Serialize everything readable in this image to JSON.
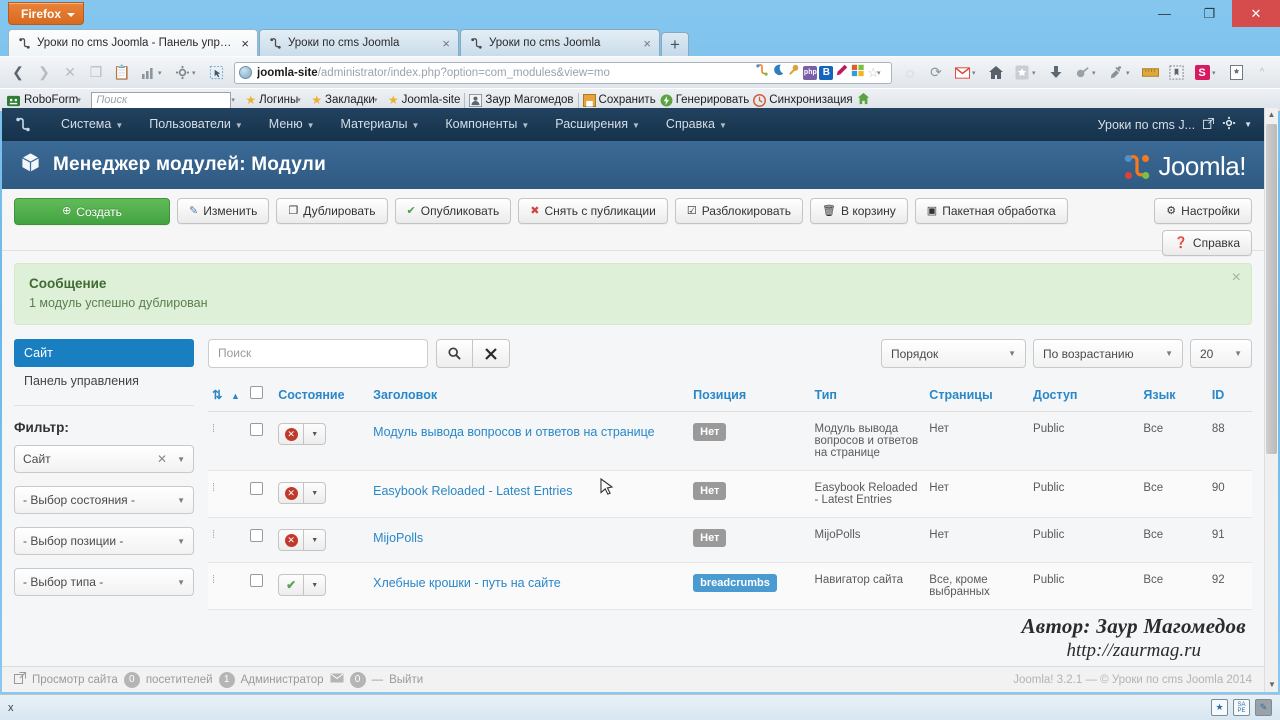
{
  "browser": {
    "app_button": "Firefox",
    "tabs": [
      {
        "title": "Уроки по cms Joomla - Панель упра...",
        "active": true,
        "close": "×"
      },
      {
        "title": "Уроки по cms Joomla",
        "active": false,
        "close": "×"
      },
      {
        "title": "Уроки по cms Joomla",
        "active": false,
        "close": "×"
      }
    ],
    "new_tab": "+",
    "window_controls": {
      "minimize": "—",
      "maximize": "❐",
      "close": "✕"
    },
    "url": {
      "host": "joomla-site",
      "path": "/administrator/index.php?option=com_modules&view=mo"
    },
    "bookmarks": {
      "roboform": "RoboForm",
      "search_placeholder": "Поиск",
      "items": [
        "Логины",
        "Закладки",
        "Joomla-site",
        "Заур Магомедов",
        "Сохранить",
        "Генерировать",
        "Синхронизация"
      ]
    }
  },
  "admin": {
    "topnav": [
      "Система",
      "Пользователи",
      "Меню",
      "Материалы",
      "Компоненты",
      "Расширения",
      "Справка"
    ],
    "site_name": "Уроки по cms J...",
    "brand": "Joomla!",
    "page_title": "Менеджер модулей: Модули"
  },
  "toolbar": {
    "new": "Создать",
    "edit": "Изменить",
    "duplicate": "Дублировать",
    "publish": "Опубликовать",
    "unpublish": "Снять с публикации",
    "checkin": "Разблокировать",
    "trash": "В корзину",
    "batch": "Пакетная обработка",
    "options": "Настройки",
    "help": "Справка"
  },
  "alert": {
    "heading": "Сообщение",
    "text": "1 модуль успешно дублирован",
    "close": "×"
  },
  "sidebar": {
    "nav": [
      {
        "label": "Сайт",
        "active": true
      },
      {
        "label": "Панель управления",
        "active": false
      }
    ],
    "filter_heading": "Фильтр:",
    "filters": [
      {
        "value": "Сайт",
        "clearable": true
      },
      {
        "value": "- Выбор состояния -",
        "clearable": false
      },
      {
        "value": "- Выбор позиции -",
        "clearable": false
      },
      {
        "value": "- Выбор типа -",
        "clearable": false
      }
    ]
  },
  "search": {
    "placeholder": "Поиск",
    "value": "",
    "search_icon": "search-icon",
    "clear_icon": "clear-icon"
  },
  "ordering": {
    "sort": "Порядок",
    "direction": "По возрастанию",
    "limit": "20"
  },
  "table": {
    "headers": [
      "Состояние",
      "Заголовок",
      "Позиция",
      "Тип",
      "Страницы",
      "Доступ",
      "Язык",
      "ID"
    ],
    "rows": [
      {
        "state": "unpublished",
        "title": "Модуль вывода вопросов и ответов на странице",
        "position": "Нет",
        "position_style": "gray",
        "type": "Модуль вывода вопросов и ответов на странице",
        "pages": "Нет",
        "access": "Public",
        "language": "Все",
        "id": "88"
      },
      {
        "state": "unpublished",
        "title": "Easybook Reloaded - Latest Entries",
        "position": "Нет",
        "position_style": "gray",
        "type": "Easybook Reloaded - Latest Entries",
        "pages": "Нет",
        "access": "Public",
        "language": "Все",
        "id": "90"
      },
      {
        "state": "unpublished",
        "title": "MijoPolls",
        "position": "Нет",
        "position_style": "gray",
        "type": "MijoPolls",
        "pages": "Нет",
        "access": "Public",
        "language": "Все",
        "id": "91"
      },
      {
        "state": "published",
        "title": "Хлебные крошки - путь на сайте",
        "position": "breadcrumbs",
        "position_style": "blue",
        "type": "Навигатор сайта",
        "pages": "Все, кроме выбранных",
        "access": "Public",
        "language": "Все",
        "id": "92"
      }
    ]
  },
  "admin_footer": {
    "preview": "Просмотр сайта",
    "visitors_count": "0",
    "visitors_label": "посетителей",
    "admins_count": "1",
    "admins_label": "Администратор",
    "messages_count": "0",
    "logout": "Выйти",
    "copyright": "Joomla! 3.2.1 — © Уроки по cms Joomla 2014"
  },
  "watermark": {
    "line1": "Автор: Заур Магомедов",
    "line2": "http://zaurmag.ru"
  },
  "statusbar": {
    "close": "x"
  },
  "colors": {
    "joomla_blue": "#2a87c8",
    "header_blue": "#3b6a96",
    "topbar_navy": "#1c3d5c",
    "success_green": "#dff0d8",
    "create_green": "#43a341",
    "sidebar_active": "#1a7fc1"
  }
}
